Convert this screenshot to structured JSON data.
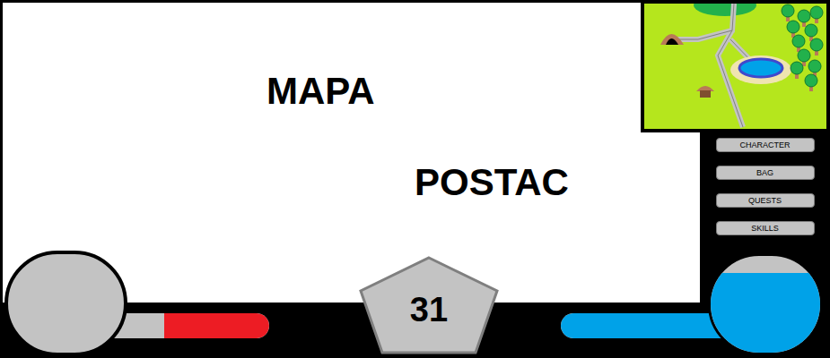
{
  "main_view": {
    "labels": [
      {
        "text": "MAPA"
      },
      {
        "text": "POSTAC"
      }
    ]
  },
  "menu": [
    {
      "label": "CHARACTER"
    },
    {
      "label": "BAG"
    },
    {
      "label": "QUESTS"
    },
    {
      "label": "SKILLS"
    }
  ],
  "health_orb": {
    "level": 0
  },
  "health_bar": {
    "level": 0.65
  },
  "mana_orb": {
    "level": 0.82
  },
  "mana_bar": {
    "level": 1
  },
  "character_level": "31"
}
